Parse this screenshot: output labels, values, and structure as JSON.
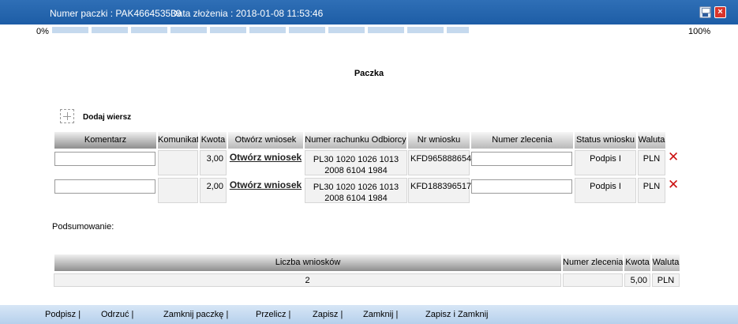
{
  "titlebar": {
    "package_number": "Numer paczki : PAK466453539",
    "created_date": "Data złożenia : 2018-01-08 11:53:46"
  },
  "progress": {
    "start_label": "0%",
    "end_label": "100%",
    "fill": 0.6
  },
  "heading": "Paczka",
  "add_row_label": "Dodaj wiersz",
  "table": {
    "headers": [
      "Komentarz",
      "Komunikat",
      "Kwota",
      "Otwórz wniosek",
      "Numer rachunku Odbiorcy",
      "Nr wniosku",
      "Numer zlecenia",
      "Status wniosku",
      "Waluta"
    ],
    "rows": [
      {
        "comment": "",
        "message": "",
        "amount": "3,00",
        "open_link": "Otwórz wniosek",
        "account_line1": "PL30 1020 1026 1013",
        "account_line2": "2008 6104 1984",
        "request_no": "KFD965888654",
        "order_no": "",
        "status": "Podpis I",
        "currency": "PLN"
      },
      {
        "comment": "",
        "message": "",
        "amount": "2,00",
        "open_link": "Otwórz wniosek",
        "account_line1": "PL30 1020 1026 1013",
        "account_line2": "2008 6104 1984",
        "request_no": "KFD188396517",
        "order_no": "",
        "status": "Podpis I",
        "currency": "PLN"
      }
    ]
  },
  "summary": {
    "label": "Podsumowanie:",
    "headers": [
      "Liczba wniosków",
      "Numer zlecenia",
      "Kwota",
      "Waluta"
    ],
    "count": "2",
    "order_no": "",
    "amount": "5,00",
    "currency": "PLN"
  },
  "footer": {
    "buttons": [
      "Podpisz |",
      "Odrzuć |",
      "Zamknij paczkę |",
      "Przelicz |",
      "Zapisz |",
      "Zamknij |",
      "Zapisz i Zamknij"
    ]
  },
  "icons": {
    "save": "floppy-disk-icon",
    "close": "close-icon",
    "add": "add-row-icon",
    "delete": "delete-x-icon"
  },
  "colors": {
    "titlebar": "#1d5da6",
    "delete": "#cc1111",
    "footer": "#c6dbf1"
  }
}
